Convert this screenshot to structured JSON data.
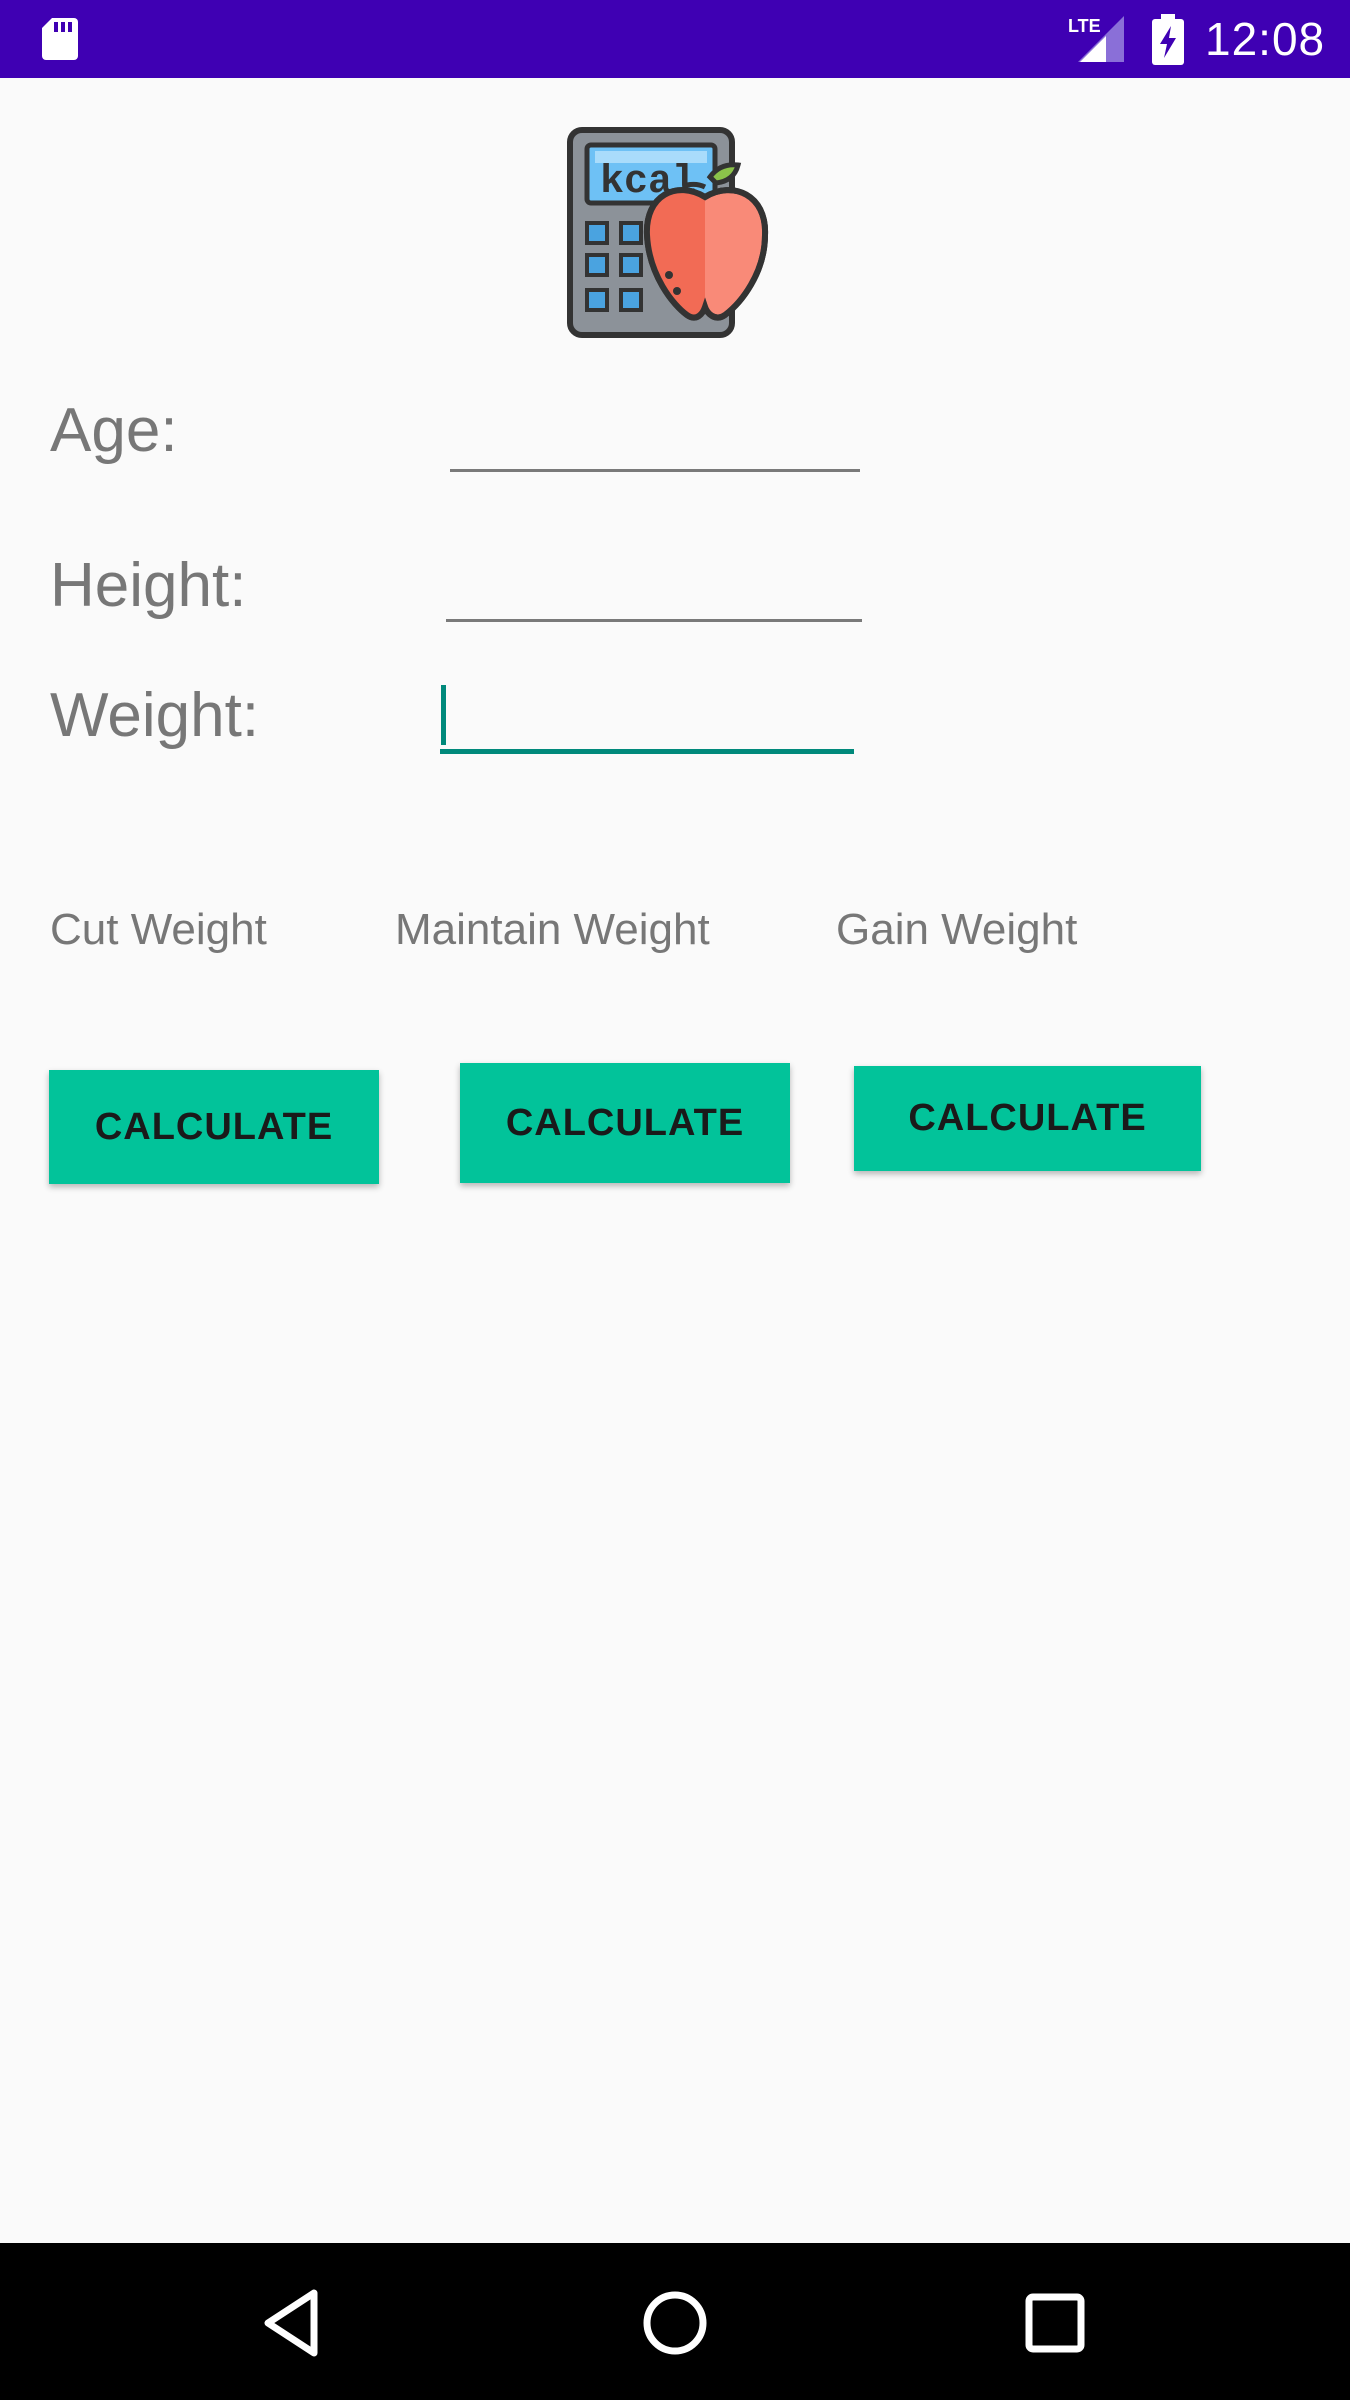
{
  "status_bar": {
    "time": "12:08",
    "background": "#3f00b3",
    "icons": [
      "sd-card-icon",
      "lte-signal-icon",
      "battery-charging-icon"
    ]
  },
  "logo": {
    "icon": "kcal-calculator-apple-icon",
    "text": "kcal"
  },
  "form": {
    "age_label": "Age:",
    "height_label": "Height:",
    "weight_label": "Weight:",
    "age_value": "",
    "height_value": "",
    "weight_value": "",
    "focused_field": "weight",
    "focus_color": "#00897b"
  },
  "options": {
    "cut_label": "Cut Weight",
    "maintain_label": "Maintain Weight",
    "gain_label": "Gain Weight"
  },
  "buttons": {
    "cut_label": "CALCULATE",
    "maintain_label": "CALCULATE",
    "gain_label": "CALCULATE",
    "color": "#02c39a"
  },
  "nav_bar": {
    "icons": [
      "back-icon",
      "home-icon",
      "recent-apps-icon"
    ]
  }
}
